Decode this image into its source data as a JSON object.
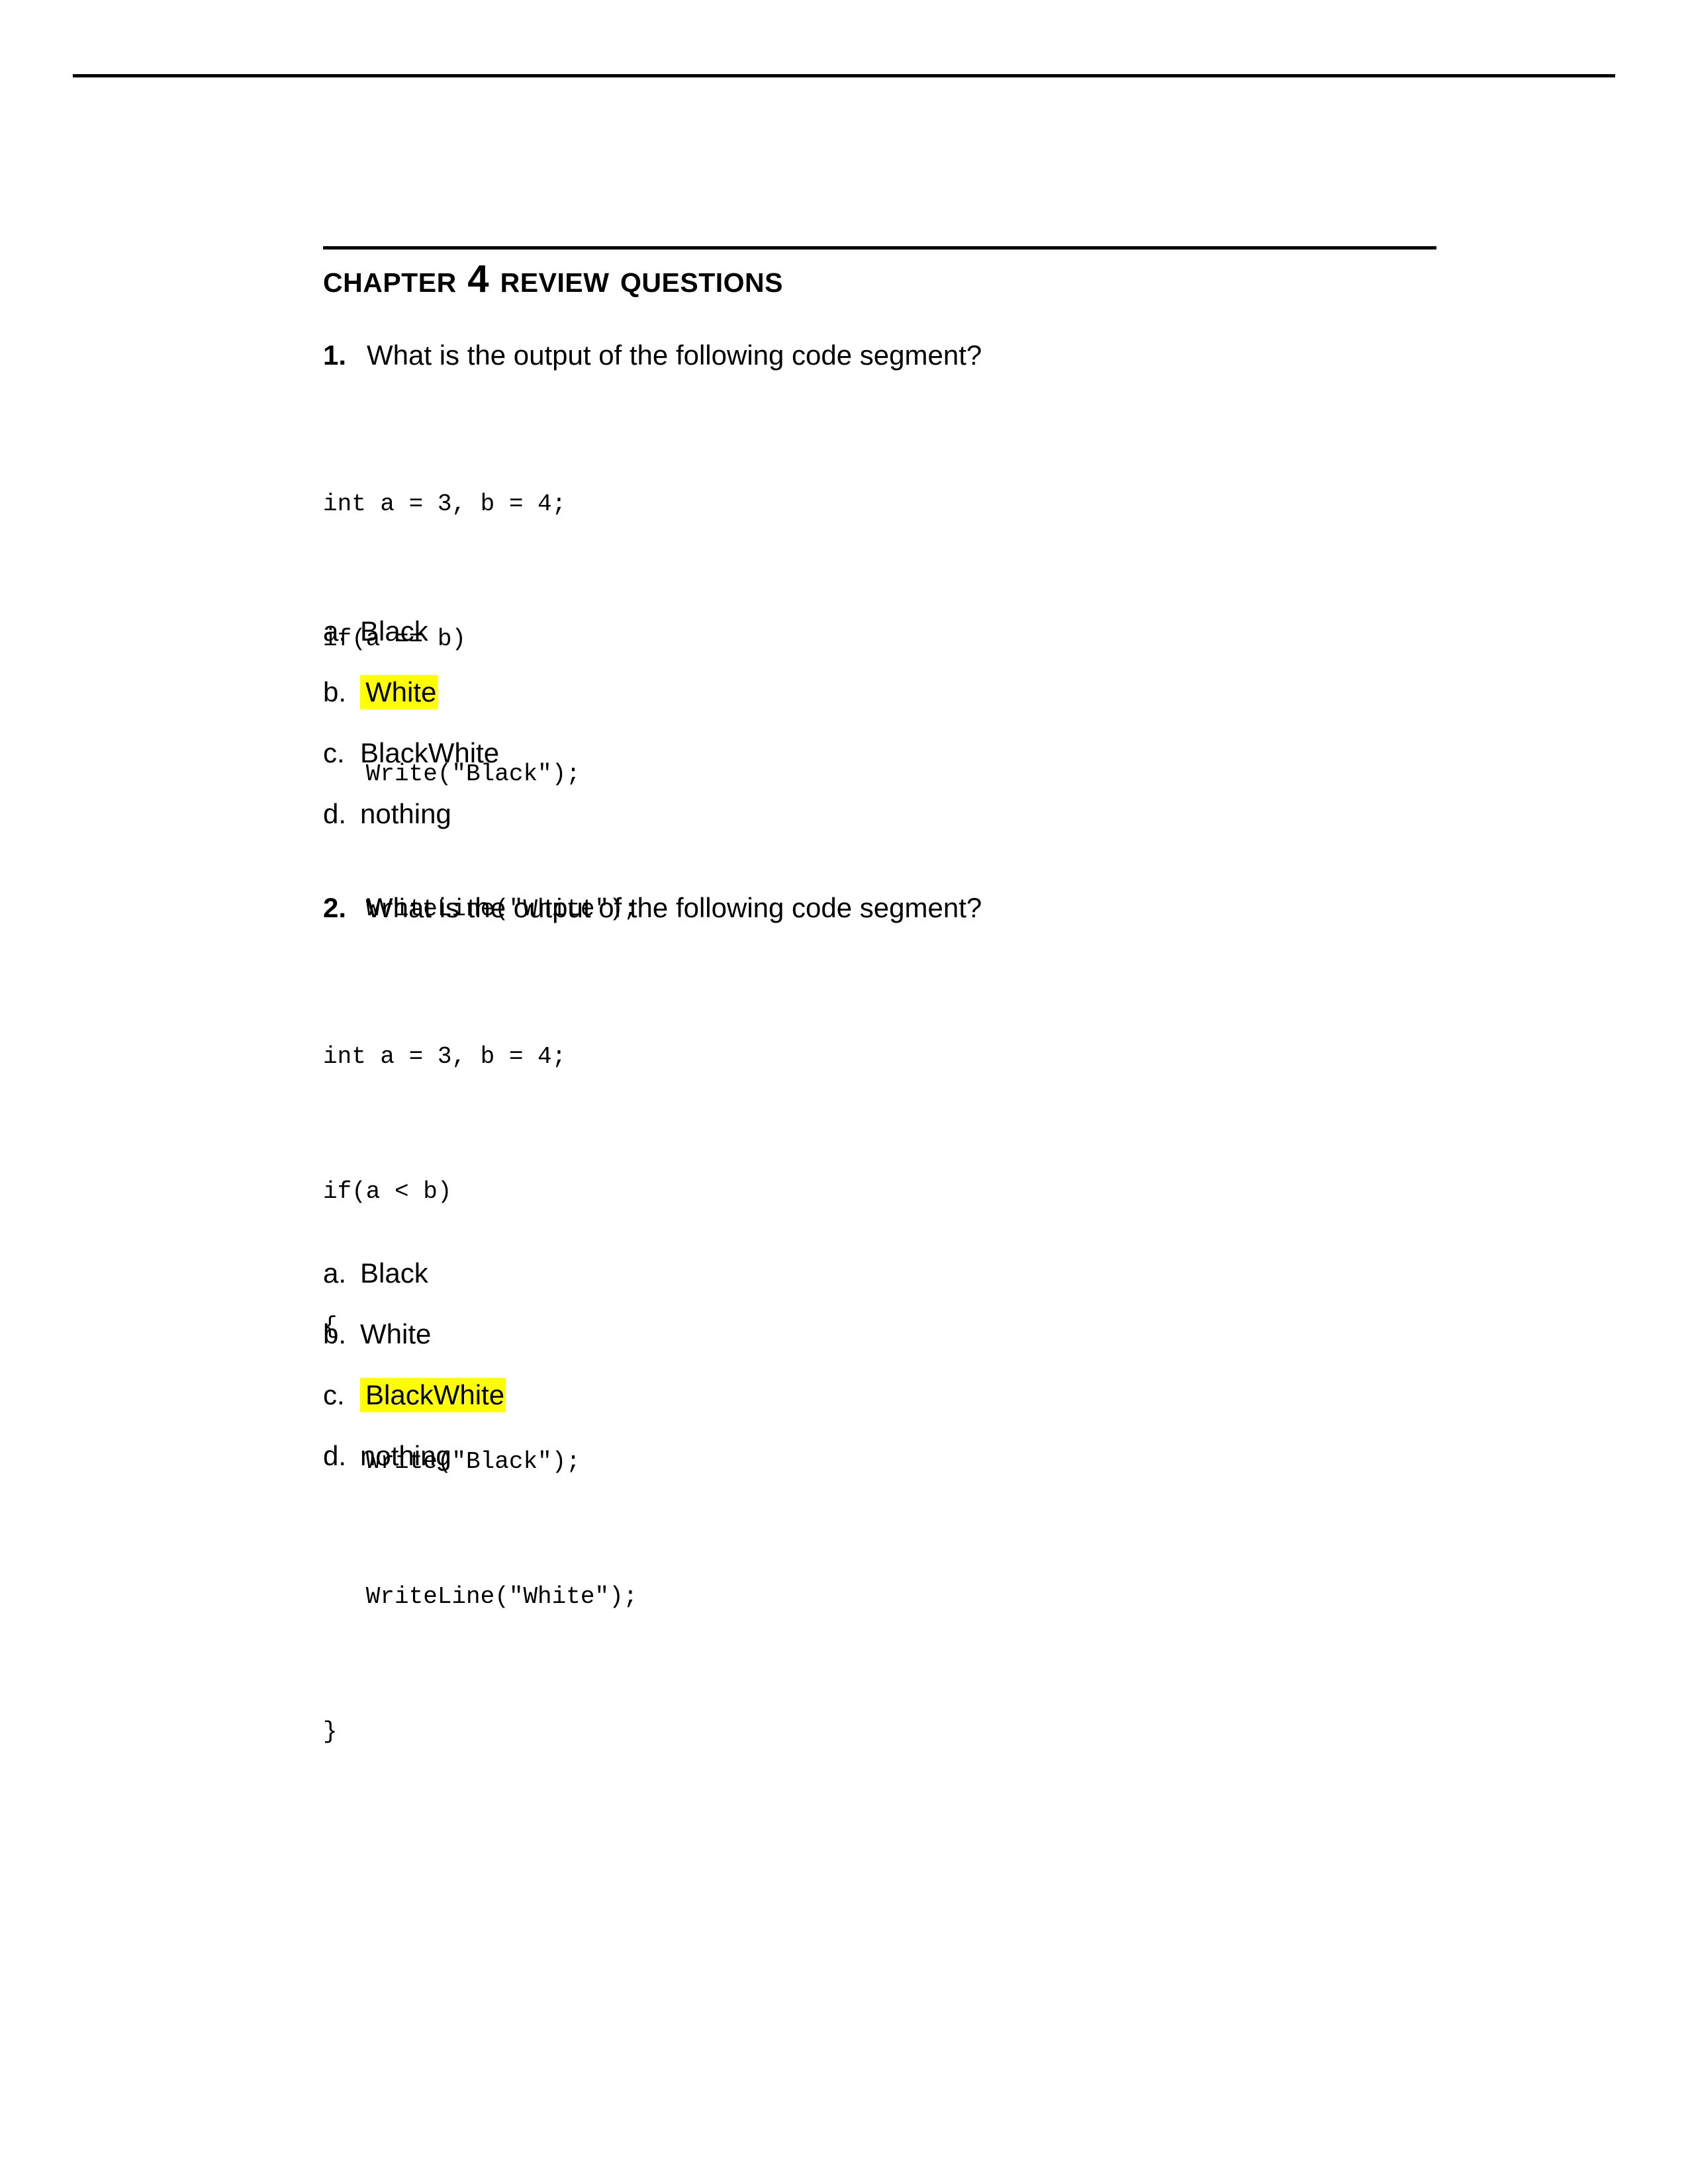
{
  "document": {
    "heading": "Chapter 4 Review Questions",
    "highlight_color": "#ffff00",
    "text_color": "#000000",
    "background_color": "#ffffff"
  },
  "questions": [
    {
      "number": "1.",
      "prompt": "What is the output of the following code segment?",
      "code": [
        "int a = 3, b = 4;",
        "if(a == b)",
        "   Write(\"Black\");",
        "   WriteLine(\"White\");"
      ],
      "options": [
        {
          "letter": "a.",
          "text": "Black",
          "highlighted": false
        },
        {
          "letter": "b.",
          "text": "White",
          "highlighted": true
        },
        {
          "letter": "c.",
          "text": "BlackWhite",
          "highlighted": false
        },
        {
          "letter": "d.",
          "text": "nothing",
          "highlighted": false
        }
      ]
    },
    {
      "number": "2.",
      "prompt": "What is the output of the following code segment?",
      "code": [
        "int a = 3, b = 4;",
        "if(a < b)",
        "{",
        "   Write(\"Black\");",
        "   WriteLine(\"White\");",
        "}"
      ],
      "options": [
        {
          "letter": "a.",
          "text": "Black",
          "highlighted": false
        },
        {
          "letter": "b.",
          "text": "White",
          "highlighted": false
        },
        {
          "letter": "c.",
          "text": "BlackWhite",
          "highlighted": true
        },
        {
          "letter": "d.",
          "text": "nothing",
          "highlighted": false
        }
      ]
    }
  ]
}
